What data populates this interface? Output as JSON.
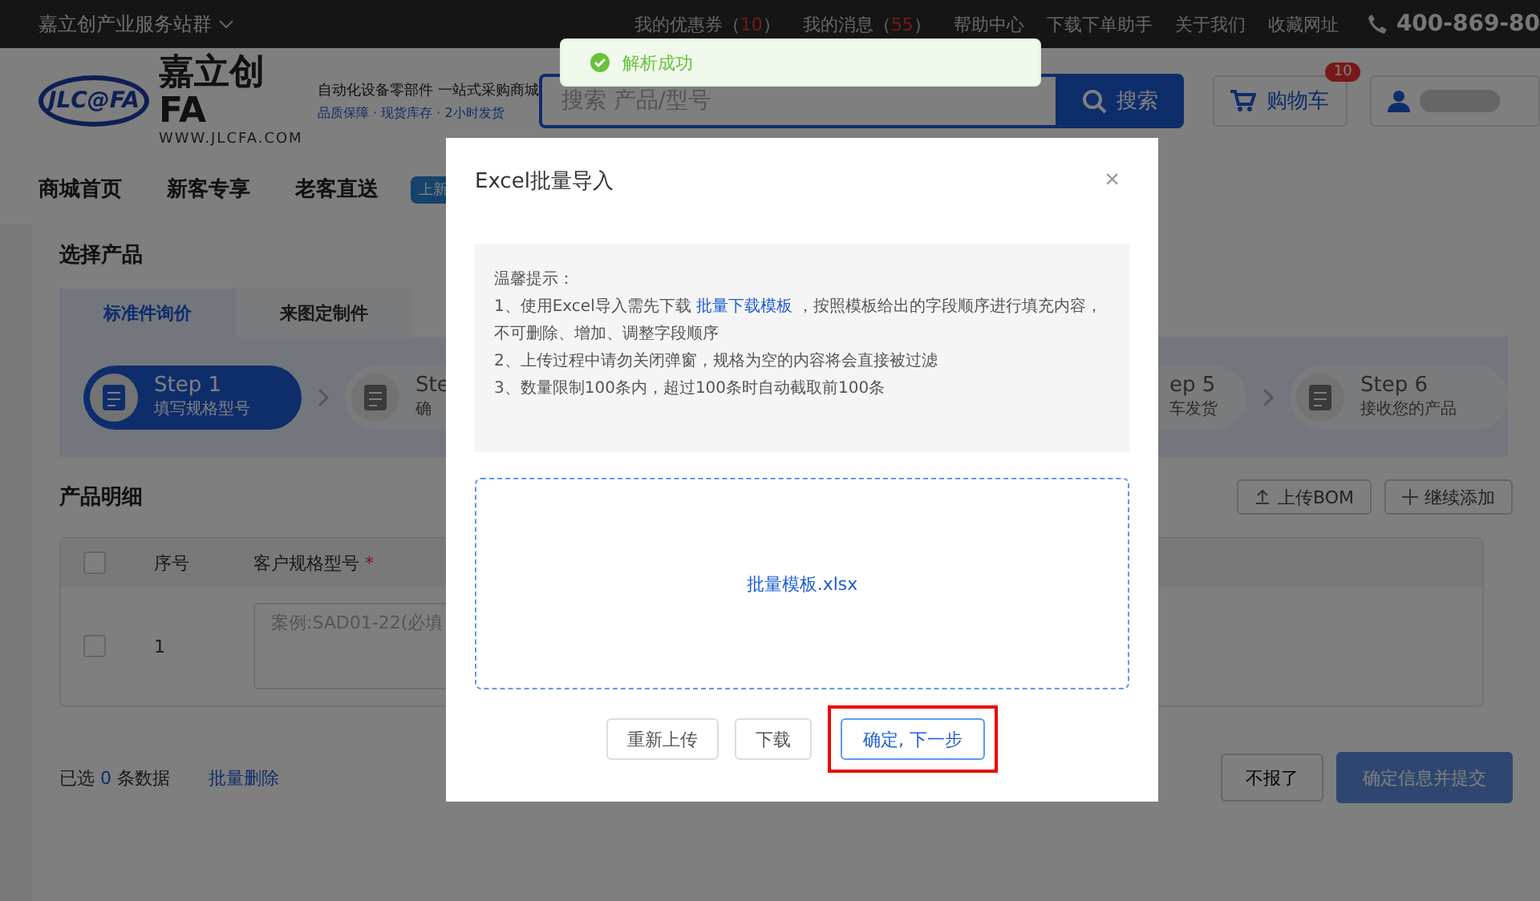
{
  "top_bar": {
    "site_menu": "嘉立创产业服务站群",
    "links": [
      {
        "prefix": "我的优惠券（",
        "count": "10",
        "suffix": "）"
      },
      {
        "prefix": "我的消息（",
        "count": "55",
        "suffix": "）"
      },
      {
        "prefix": "帮助中心"
      },
      {
        "prefix": "下载下单助手"
      },
      {
        "prefix": "关于我们"
      },
      {
        "prefix": "收藏网址"
      }
    ],
    "phone": "400-869-80"
  },
  "header": {
    "logo_mark": "JLC@FA",
    "brand": "嘉立创FA",
    "url": "WWW.JLCFA.COM",
    "slogan": "自动化设备零部件 一站式采购商城",
    "features": "品质保障 · 现货库存 · 2小时发货",
    "search": {
      "placeholder": "搜索 产品/型号",
      "button": "搜索"
    },
    "cart": {
      "label": "购物车",
      "badge": "10"
    }
  },
  "nav": {
    "items": [
      "商城首页",
      "新客专享",
      "老客直送"
    ],
    "badge": "上新"
  },
  "select_product": {
    "title": "选择产品",
    "tabs": [
      {
        "label": "标准件询价",
        "selected": true
      },
      {
        "label": "来图定制件",
        "selected": false
      }
    ],
    "steps": [
      {
        "title": "Step 1",
        "subtitle": "填写规格型号",
        "selected": true
      },
      {
        "title": "Ste",
        "subtitle": "确",
        "selected": false
      },
      {
        "title": "ep 5",
        "subtitle": "车发货",
        "selected": false
      },
      {
        "title": "Step 6",
        "subtitle": "接收您的产品",
        "selected": false
      }
    ]
  },
  "details": {
    "title": "产品明细",
    "actions": [
      {
        "kind": "upload",
        "label": "上传BOM"
      },
      {
        "kind": "add",
        "label": "继续添加"
      }
    ],
    "table": {
      "columns": [
        "序号",
        "客户规格型号"
      ],
      "required_mark": "*",
      "rows": [
        {
          "index": "1",
          "checked": false,
          "placeholder": "案例:SAD01-22(必填"
        }
      ],
      "header_checked": false
    },
    "summary": {
      "prefix": "已选",
      "count": "0",
      "suffix": "条数据"
    },
    "bulk_delete": "批量删除",
    "cancel": "不报了",
    "submit": "确定信息并提交"
  },
  "toast": {
    "message": "解析成功"
  },
  "dialog": {
    "title": "Excel批量导入",
    "close": "×",
    "tip_title": "温馨提示：",
    "tip_lines": [
      {
        "before": "1、使用Excel导入需先下载 ",
        "link": "批量下载模板",
        "after": " ，按照模板给出的字段顺序进行填充内容，不可删除、增加、调整字段顺序"
      },
      {
        "before": "2、上传过程中请勿关闭弹窗，规格为空的内容将会直接被过滤"
      },
      {
        "before": "3、数量限制100条内，超过100条时自动截取前100条"
      }
    ],
    "file": "批量模板.xlsx",
    "buttons": [
      {
        "label": "重新上传",
        "primary": false,
        "highlighted": false
      },
      {
        "label": "下载",
        "primary": false,
        "highlighted": false
      },
      {
        "label": "确定, 下一步",
        "primary": true,
        "highlighted": true
      }
    ]
  }
}
